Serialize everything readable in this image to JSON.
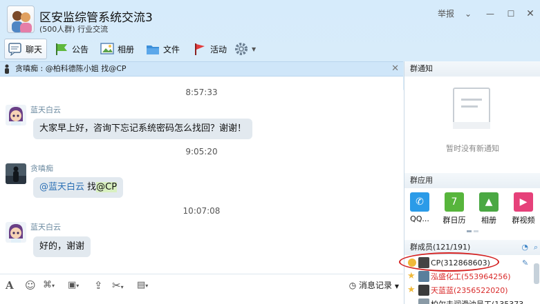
{
  "header": {
    "group_name": "区安监综管系统交流3",
    "subtitle": "(500人群) 行业交流",
    "report": "举报"
  },
  "toolbar": {
    "items": [
      {
        "label": "聊天",
        "icon": "chat-icon"
      },
      {
        "label": "公告",
        "icon": "announcement-flag-icon"
      },
      {
        "label": "相册",
        "icon": "photo-album-icon"
      },
      {
        "label": "文件",
        "icon": "folder-icon"
      },
      {
        "label": "活动",
        "icon": "event-flag-icon"
      }
    ],
    "settings_icon": "gear-icon"
  },
  "notice": {
    "text": "贪嗔痴 : @柏科德陈小姐 找@CP"
  },
  "chat": {
    "messages": [
      {
        "time": "8:57:33",
        "sender": "蓝天白云",
        "text": "大家早上好，咨询下忘记系统密码怎么找回？谢谢！"
      },
      {
        "time": "9:05:20",
        "sender": "贪嗔痴",
        "mention": "@蓝天白云",
        "text_mid": " 找",
        "mention2": "@CP"
      },
      {
        "time": "10:07:08",
        "sender": "蓝天白云",
        "text": "好的，谢谢"
      }
    ]
  },
  "input_bar": {
    "icons": [
      "font-icon",
      "emoji-icon",
      "magic-icon",
      "image-icon",
      "upload-icon",
      "scissors-icon",
      "redpacket-icon"
    ],
    "history_label": "消息记录"
  },
  "side": {
    "notice_header": "群通知",
    "notice_empty": "暂时没有新通知",
    "apps_header": "群应用",
    "apps": [
      {
        "label": "QQ...",
        "icon": "phone-icon",
        "color": "#2b9be8"
      },
      {
        "label": "群日历",
        "icon": "calendar-icon",
        "color": "#57b53c"
      },
      {
        "label": "相册",
        "icon": "photo-icon",
        "color": "#4aa843"
      },
      {
        "label": "群视频",
        "icon": "video-icon",
        "color": "#e6417a"
      }
    ],
    "members_header": "群成员(121/191)",
    "members": [
      {
        "name": "CP(312868603)",
        "color": "#222"
      },
      {
        "name": "泓盛化工(553964256)",
        "color": "#d92b2b"
      },
      {
        "name": "天蓝蓝(2356522020)",
        "color": "#d92b2b"
      },
      {
        "name": "柏尔夫润滑油吴工(135373",
        "color": "#222"
      }
    ]
  }
}
